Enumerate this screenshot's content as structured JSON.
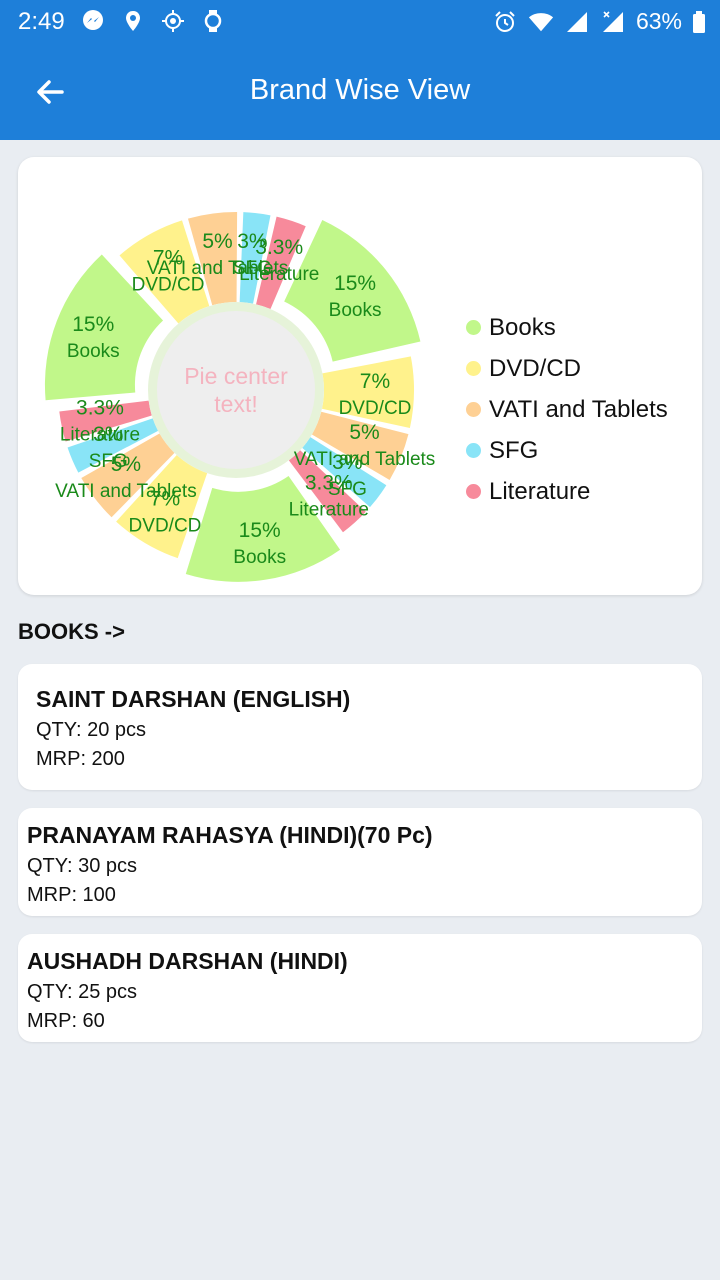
{
  "status_bar": {
    "time": "2:49",
    "battery": "63%",
    "icons_left": [
      "messenger-icon",
      "location-icon",
      "gps-icon",
      "watch-icon"
    ],
    "icons_right": [
      "alarm-icon",
      "wifi-icon",
      "signal-icon",
      "signal-x-icon",
      "battery-icon"
    ]
  },
  "app_bar": {
    "title": "Brand Wise View",
    "back_icon": "arrow-left-icon"
  },
  "chart_data": {
    "type": "pie",
    "center_text": "Pie center text!",
    "legend_position": "right",
    "categories": [
      "Books",
      "DVD/CD",
      "VATI and Tablets",
      "SFG",
      "Literature"
    ],
    "colors": [
      "#c1f78a",
      "#fff28c",
      "#fed094",
      "#89e4f7",
      "#f78a9b"
    ],
    "slices": [
      {
        "label": "Books",
        "value": 15
      },
      {
        "label": "DVD/CD",
        "value": 7
      },
      {
        "label": "VATI and Tablets",
        "value": 5
      },
      {
        "label": "SFG",
        "value": 3
      },
      {
        "label": "Literature",
        "value": 3.3
      },
      {
        "label": "Books",
        "value": 15
      },
      {
        "label": "DVD/CD",
        "value": 7
      },
      {
        "label": "VATI and Tablets",
        "value": 5
      },
      {
        "label": "SFG",
        "value": 3
      },
      {
        "label": "Literature",
        "value": 3.3
      },
      {
        "label": "Books",
        "value": 15
      },
      {
        "label": "DVD/CD",
        "value": 7
      },
      {
        "label": "VATI and Tablets",
        "value": 5
      },
      {
        "label": "SFG",
        "value": 3
      },
      {
        "label": "Literature",
        "value": 3.3
      }
    ],
    "value_labels": [
      "15%",
      "7%",
      "5%",
      "3%",
      "3.3%",
      "15%",
      "7%",
      "5%",
      "3%",
      "3.3%",
      "15%",
      "7%",
      "5%",
      "3%",
      "3.3%"
    ]
  },
  "section": {
    "title": "BOOKS ->"
  },
  "products": [
    {
      "name": "SAINT DARSHAN (ENGLISH)",
      "qty": "QTY: 20 pcs",
      "mrp": "MRP: 200"
    },
    {
      "name": "PRANAYAM RAHASYA (HINDI)(70 Pc)",
      "qty": "QTY: 30 pcs",
      "mrp": "MRP: 100"
    },
    {
      "name": "AUSHADH DARSHAN (HINDI)",
      "qty": "QTY: 25 pcs",
      "mrp": "MRP: 60"
    }
  ]
}
